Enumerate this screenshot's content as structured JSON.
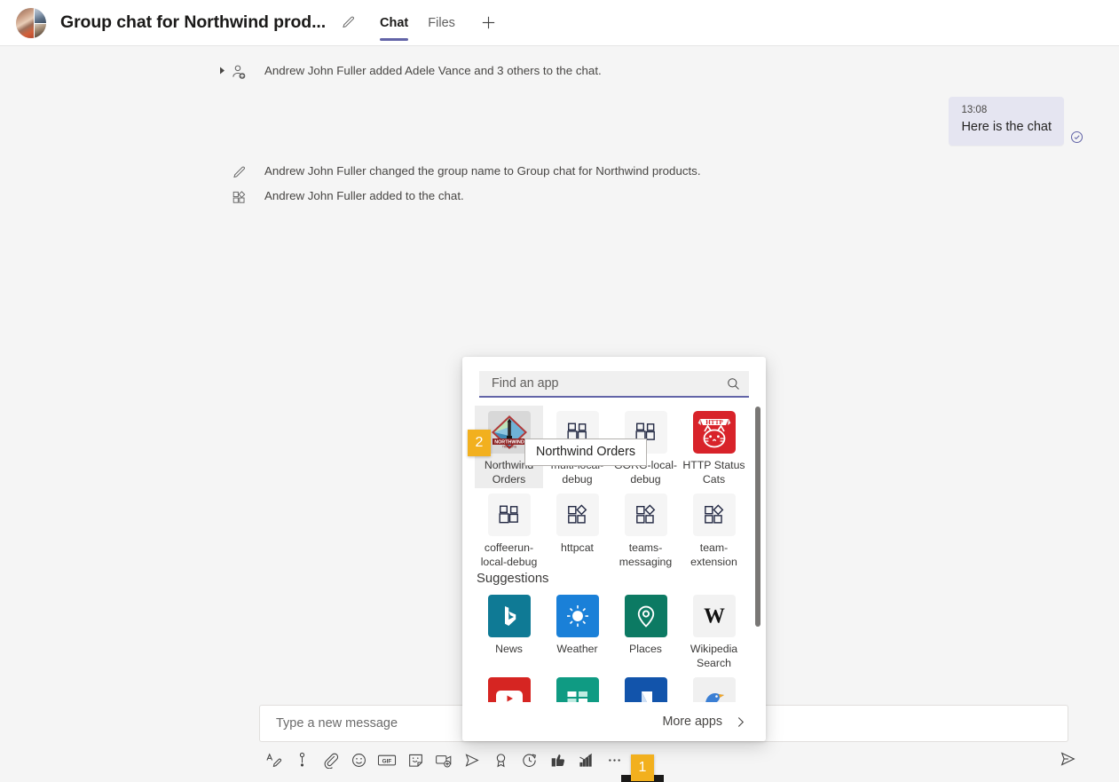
{
  "header": {
    "avatar_name": "group-avatar",
    "title": "Group chat for Northwind prod...",
    "edit_icon": "pencil-icon",
    "tabs": [
      {
        "label": "Chat",
        "active": true
      },
      {
        "label": "Files",
        "active": false
      }
    ],
    "add_tab_icon": "plus-icon"
  },
  "messages": {
    "system_events": [
      {
        "icon": "add-person-icon",
        "text": "Andrew John Fuller added Adele Vance and 3 others to the chat.",
        "expandable": true
      },
      {
        "icon": "pencil-icon",
        "text": "Andrew John Fuller changed the group name to Group chat for Northwind products.",
        "expandable": false
      },
      {
        "icon": "app-puzzle-icon",
        "text": "Andrew John Fuller added to the chat.",
        "expandable": false
      }
    ],
    "outgoing": {
      "time": "13:08",
      "text": "Here is the chat",
      "receipt_icon": "seen-check-circle-icon",
      "receipt_color": "#6264a7",
      "bubble_color": "#e5e5f1"
    }
  },
  "compose": {
    "placeholder": "Type a new message",
    "value": "",
    "send_icon": "send-icon",
    "toolbar": [
      {
        "icon": "format-text-icon",
        "name": "format-button"
      },
      {
        "icon": "priority-icon",
        "name": "set-delivery-options-button"
      },
      {
        "icon": "attach-icon",
        "name": "attach-file-button"
      },
      {
        "icon": "emoji-icon",
        "name": "emoji-button"
      },
      {
        "icon": "gif-icon",
        "name": "giphy-button"
      },
      {
        "icon": "sticker-icon",
        "name": "sticker-button"
      },
      {
        "icon": "meet-now-icon",
        "name": "meet-now-button"
      },
      {
        "icon": "stream-icon",
        "name": "stream-button"
      },
      {
        "icon": "praise-icon",
        "name": "praise-button"
      },
      {
        "icon": "schedule-icon",
        "name": "schedule-button"
      },
      {
        "icon": "approvals-icon",
        "name": "approvals-button"
      },
      {
        "icon": "chart-icon",
        "name": "updates-button"
      },
      {
        "icon": "more-icon",
        "name": "more-options-button"
      }
    ]
  },
  "app_flyout": {
    "search": {
      "placeholder": "Find an app",
      "value": "",
      "icon": "search-icon",
      "accent_color": "#6264a7"
    },
    "apps": [
      {
        "label": "Northwind Orders",
        "icon": "northwind-traders-logo",
        "selected": true
      },
      {
        "label": "multi-local-debug",
        "icon": "app-blocks-icon",
        "selected": false
      },
      {
        "label": "GORG-local-debug",
        "icon": "app-blocks-icon",
        "selected": false
      },
      {
        "label": "HTTP Status Cats",
        "icon": "http-status-cats-logo",
        "selected": false
      },
      {
        "label": "coffeerun-local-debug",
        "icon": "app-blocks-icon",
        "selected": false
      },
      {
        "label": "httpcat",
        "icon": "app-diamond-icon",
        "selected": false
      },
      {
        "label": "teams-messaging",
        "icon": "app-diamond-icon",
        "selected": false
      },
      {
        "label": "team-extension",
        "icon": "app-diamond-icon",
        "selected": false
      }
    ],
    "suggestions_heading": "Suggestions",
    "suggestions": [
      {
        "label": "News",
        "icon": "bing-news-icon",
        "color": "#0f7a95"
      },
      {
        "label": "Weather",
        "icon": "weather-sun-icon",
        "color": "#1a80d8"
      },
      {
        "label": "Places",
        "icon": "places-pin-icon",
        "color": "#0c7a63"
      },
      {
        "label": "Wikipedia Search",
        "icon": "wikipedia-icon",
        "color": "#f2f2f2"
      }
    ],
    "suggestions_row2": [
      {
        "label": "",
        "icon": "youtube-icon",
        "color": "#d62522"
      },
      {
        "label": "",
        "icon": "trello-board-icon",
        "color": "#0f9b83"
      },
      {
        "label": "",
        "icon": "blue-app-icon",
        "color": "#1254ab"
      },
      {
        "label": "",
        "icon": "bird-app-icon",
        "color": "#f0f0f0"
      }
    ],
    "more_apps_label": "More apps",
    "more_apps_chevron": "chevron-right-icon",
    "scrollbar": "vertical-scrollbar"
  },
  "tooltip": {
    "text": "Northwind Orders"
  },
  "step_badges": [
    {
      "number": "1",
      "target": "more-options-button"
    },
    {
      "number": "2",
      "target": "northwind-orders-app"
    }
  ]
}
